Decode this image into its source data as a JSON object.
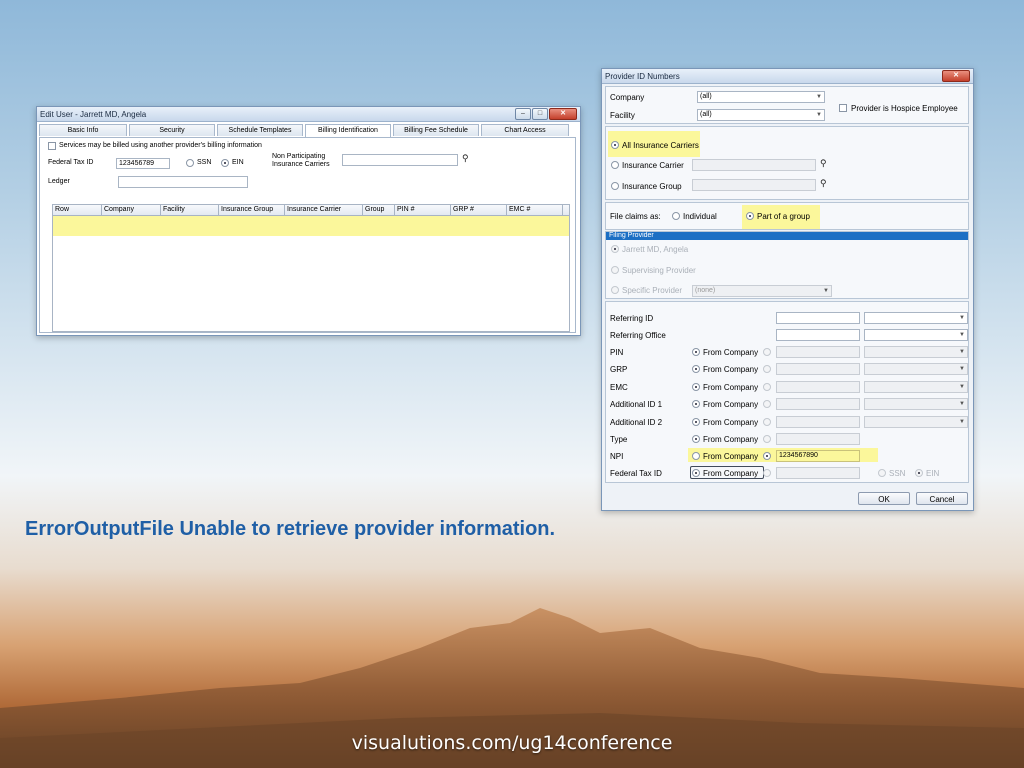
{
  "edit_user": {
    "title": "Edit User - Jarrett MD, Angela",
    "tabs": [
      "Basic Info",
      "Security",
      "Schedule Templates",
      "Billing Identification",
      "Billing Fee Schedule",
      "Chart Access"
    ],
    "active_tab": "Billing Identification",
    "services_label": "Services may be billed using another provider's billing information",
    "federal_tax_label": "Federal Tax ID",
    "federal_tax_value": "123456789",
    "ssn_label": "SSN",
    "ein_label": "EIN",
    "non_participating_label_1": "Non Participating",
    "non_participating_label_2": "Insurance Carriers",
    "ledger_label": "Ledger",
    "grid_columns": [
      "Row",
      "Company",
      "Facility",
      "Insurance Group",
      "Insurance Carrier",
      "Group",
      "PIN #",
      "GRP #",
      "EMC #"
    ]
  },
  "provider_dialog": {
    "title": "Provider ID Numbers",
    "company_label": "Company",
    "company_value": "(all)",
    "facility_label": "Facility",
    "facility_value": "(all)",
    "hospice_label": "Provider is Hospice Employee",
    "all_carriers_label": "All Insurance Carriers",
    "carrier_label": "Insurance Carrier",
    "group_label": "Insurance Group",
    "file_claims_label": "File claims as:",
    "individual_label": "Individual",
    "part_of_group_label": "Part of a group",
    "filing_provider_header": "Filing Provider",
    "filing_options": [
      "Jarrett MD, Angela",
      "Supervising Provider",
      "Specific Provider"
    ],
    "specific_value": "(none)",
    "rows": [
      {
        "label": "Referring ID"
      },
      {
        "label": "Referring Office"
      },
      {
        "label": "PIN",
        "from": "From Company"
      },
      {
        "label": "GRP",
        "from": "From Company"
      },
      {
        "label": "EMC",
        "from": "From Company"
      },
      {
        "label": "Additional ID 1",
        "from": "From Company"
      },
      {
        "label": "Additional ID 2",
        "from": "From Company"
      },
      {
        "label": "Type",
        "from": "From Company"
      },
      {
        "label": "NPI",
        "from": "From Company",
        "value": "1234567890"
      },
      {
        "label": "Federal Tax ID",
        "from": "From Company"
      }
    ],
    "ssn_label": "SSN",
    "ein_label": "EIN",
    "ok_label": "OK",
    "cancel_label": "Cancel"
  },
  "error_message": "ErrorOutputFile Unable to retrieve provider information.",
  "footer_url": "visualutions.com/ug14conference",
  "colors": {
    "accent_text": "#1f5fa6",
    "highlight": "#fbf79b",
    "filing_header": "#1c6fc4"
  }
}
